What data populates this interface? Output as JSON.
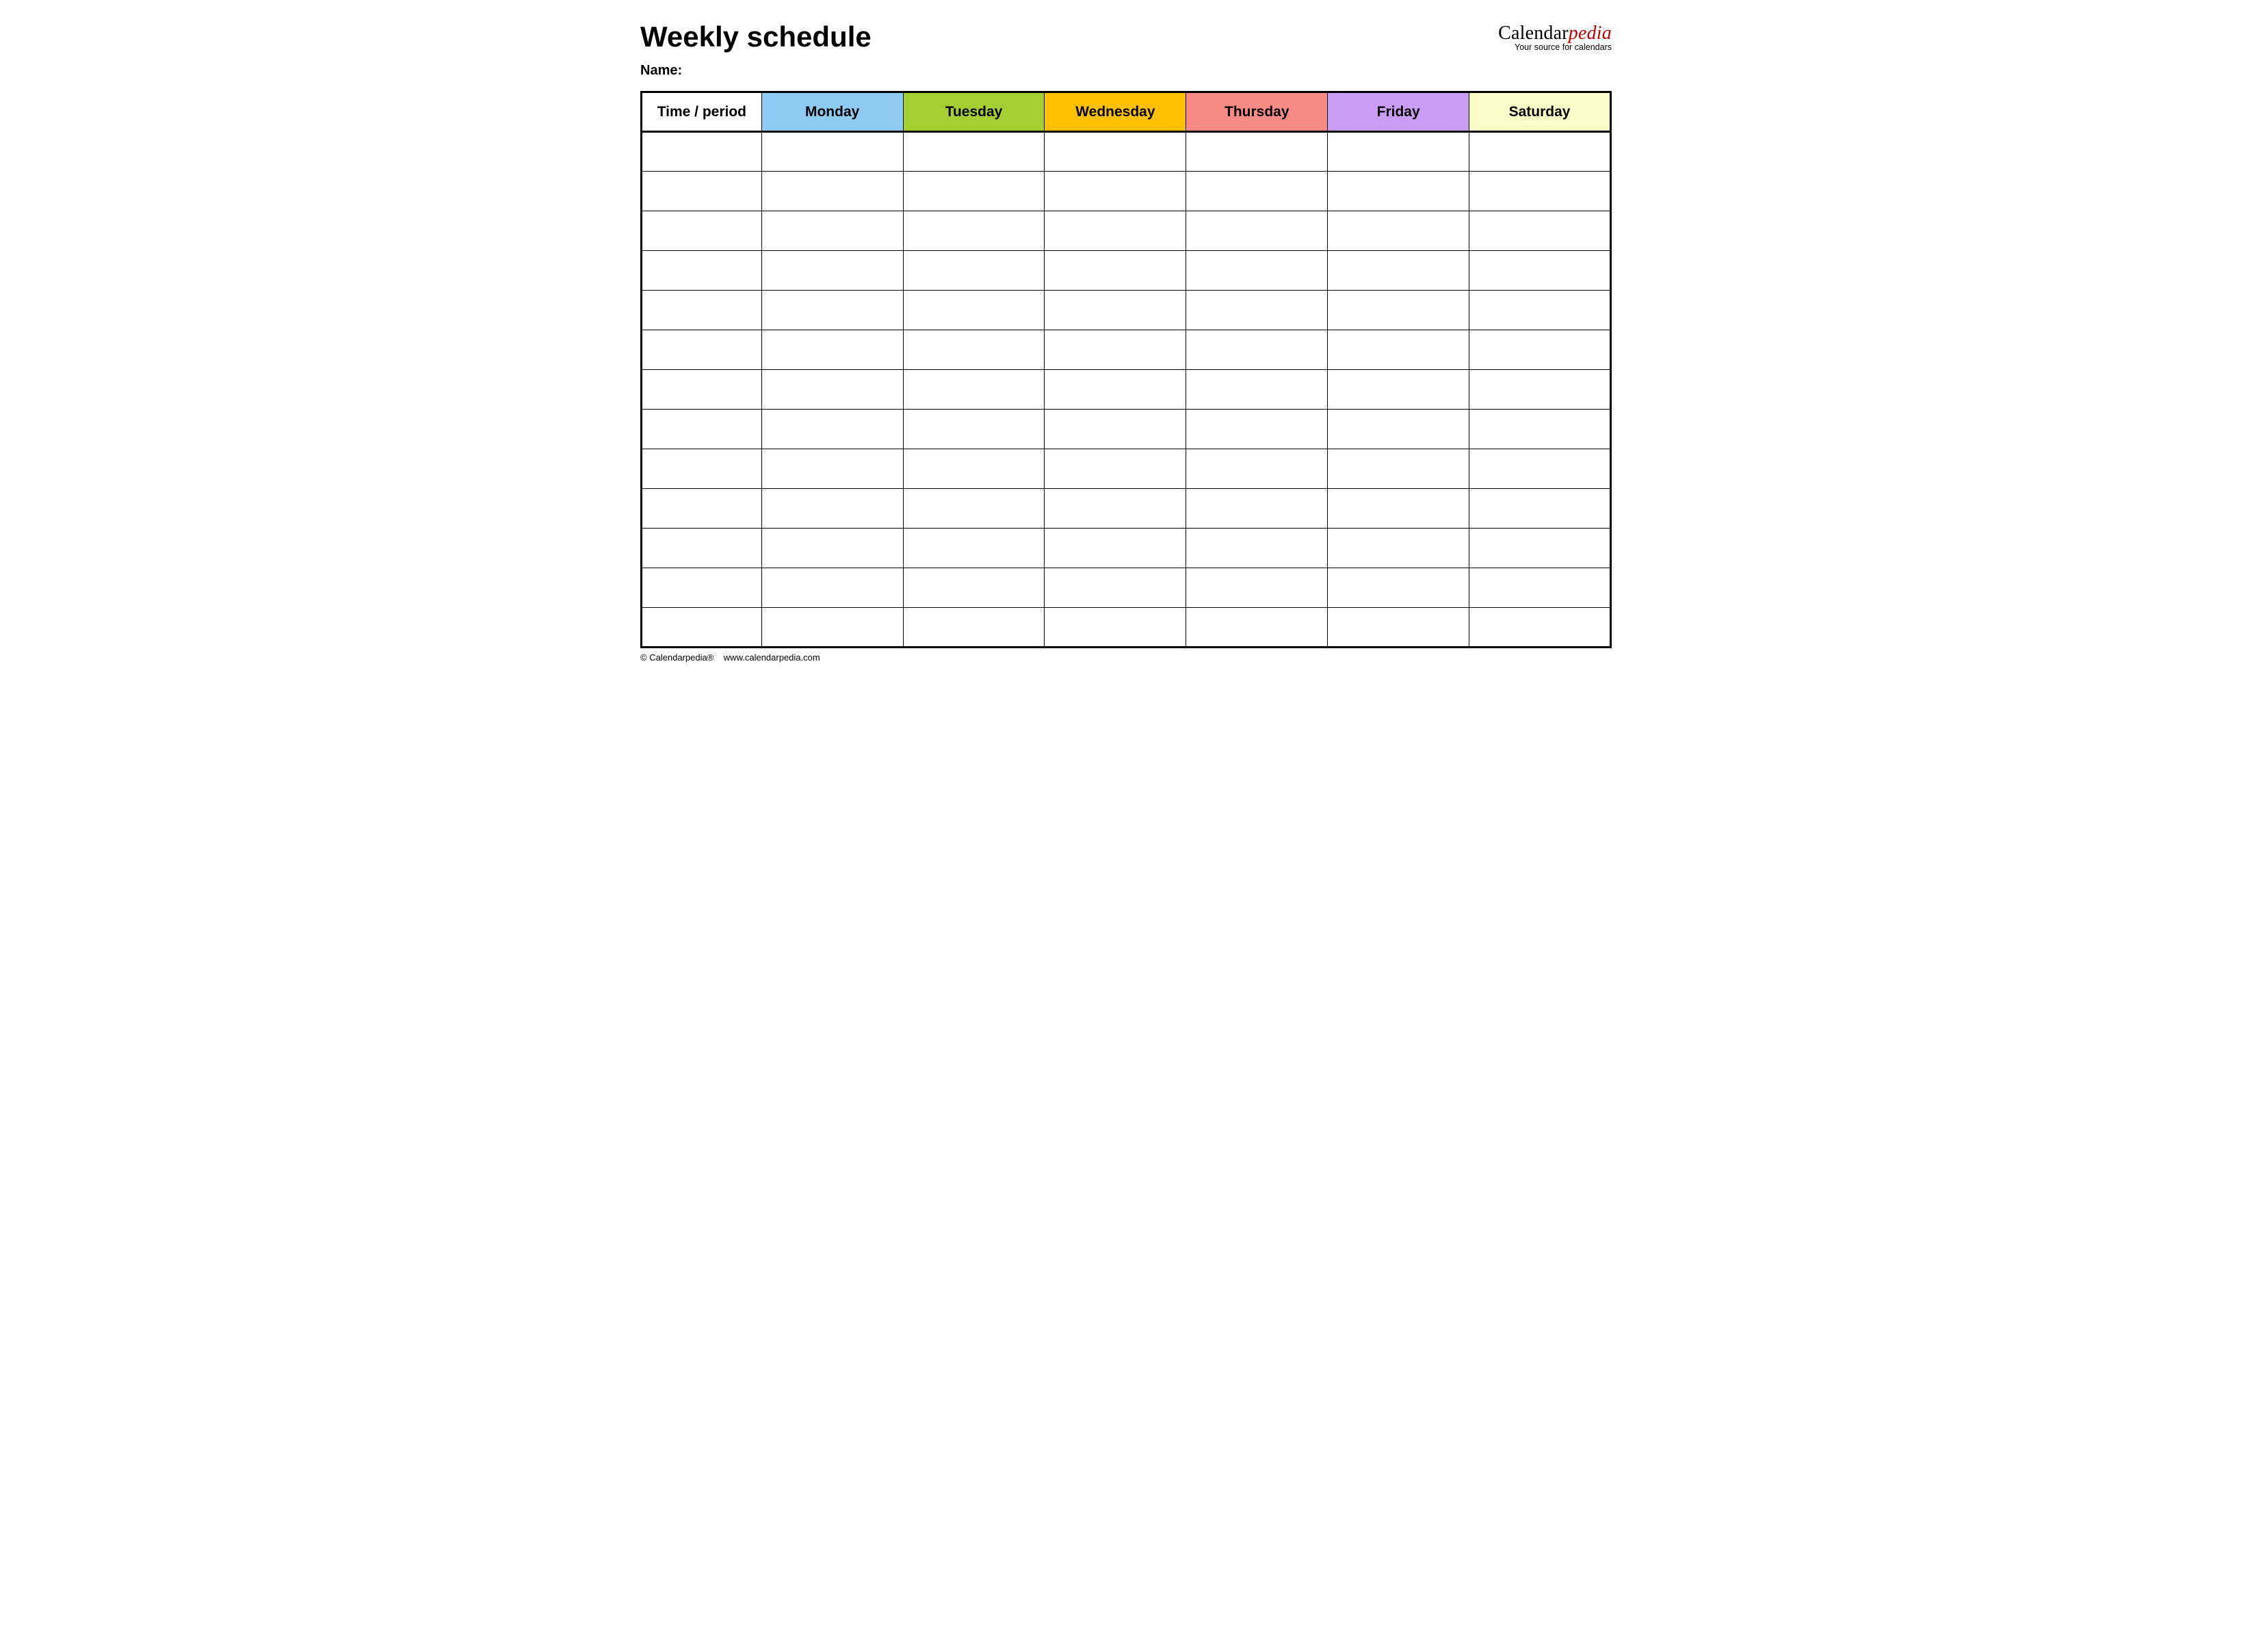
{
  "title": "Weekly schedule",
  "name_label": "Name:",
  "brand": {
    "prefix": "Calendar",
    "suffix": "pedia",
    "tagline": "Your source for calendars"
  },
  "columns": [
    {
      "label": "Time / period",
      "bg": "#ffffff"
    },
    {
      "label": "Monday",
      "bg": "#8fcaf2"
    },
    {
      "label": "Tuesday",
      "bg": "#a3cf33"
    },
    {
      "label": "Wednesday",
      "bg": "#ffc000"
    },
    {
      "label": "Thursday",
      "bg": "#f98b86"
    },
    {
      "label": "Friday",
      "bg": "#c99df4"
    },
    {
      "label": "Saturday",
      "bg": "#fbfbc6"
    }
  ],
  "body_rows": 13,
  "footer": {
    "copyright": "© Calendarpedia®",
    "url": "www.calendarpedia.com"
  }
}
